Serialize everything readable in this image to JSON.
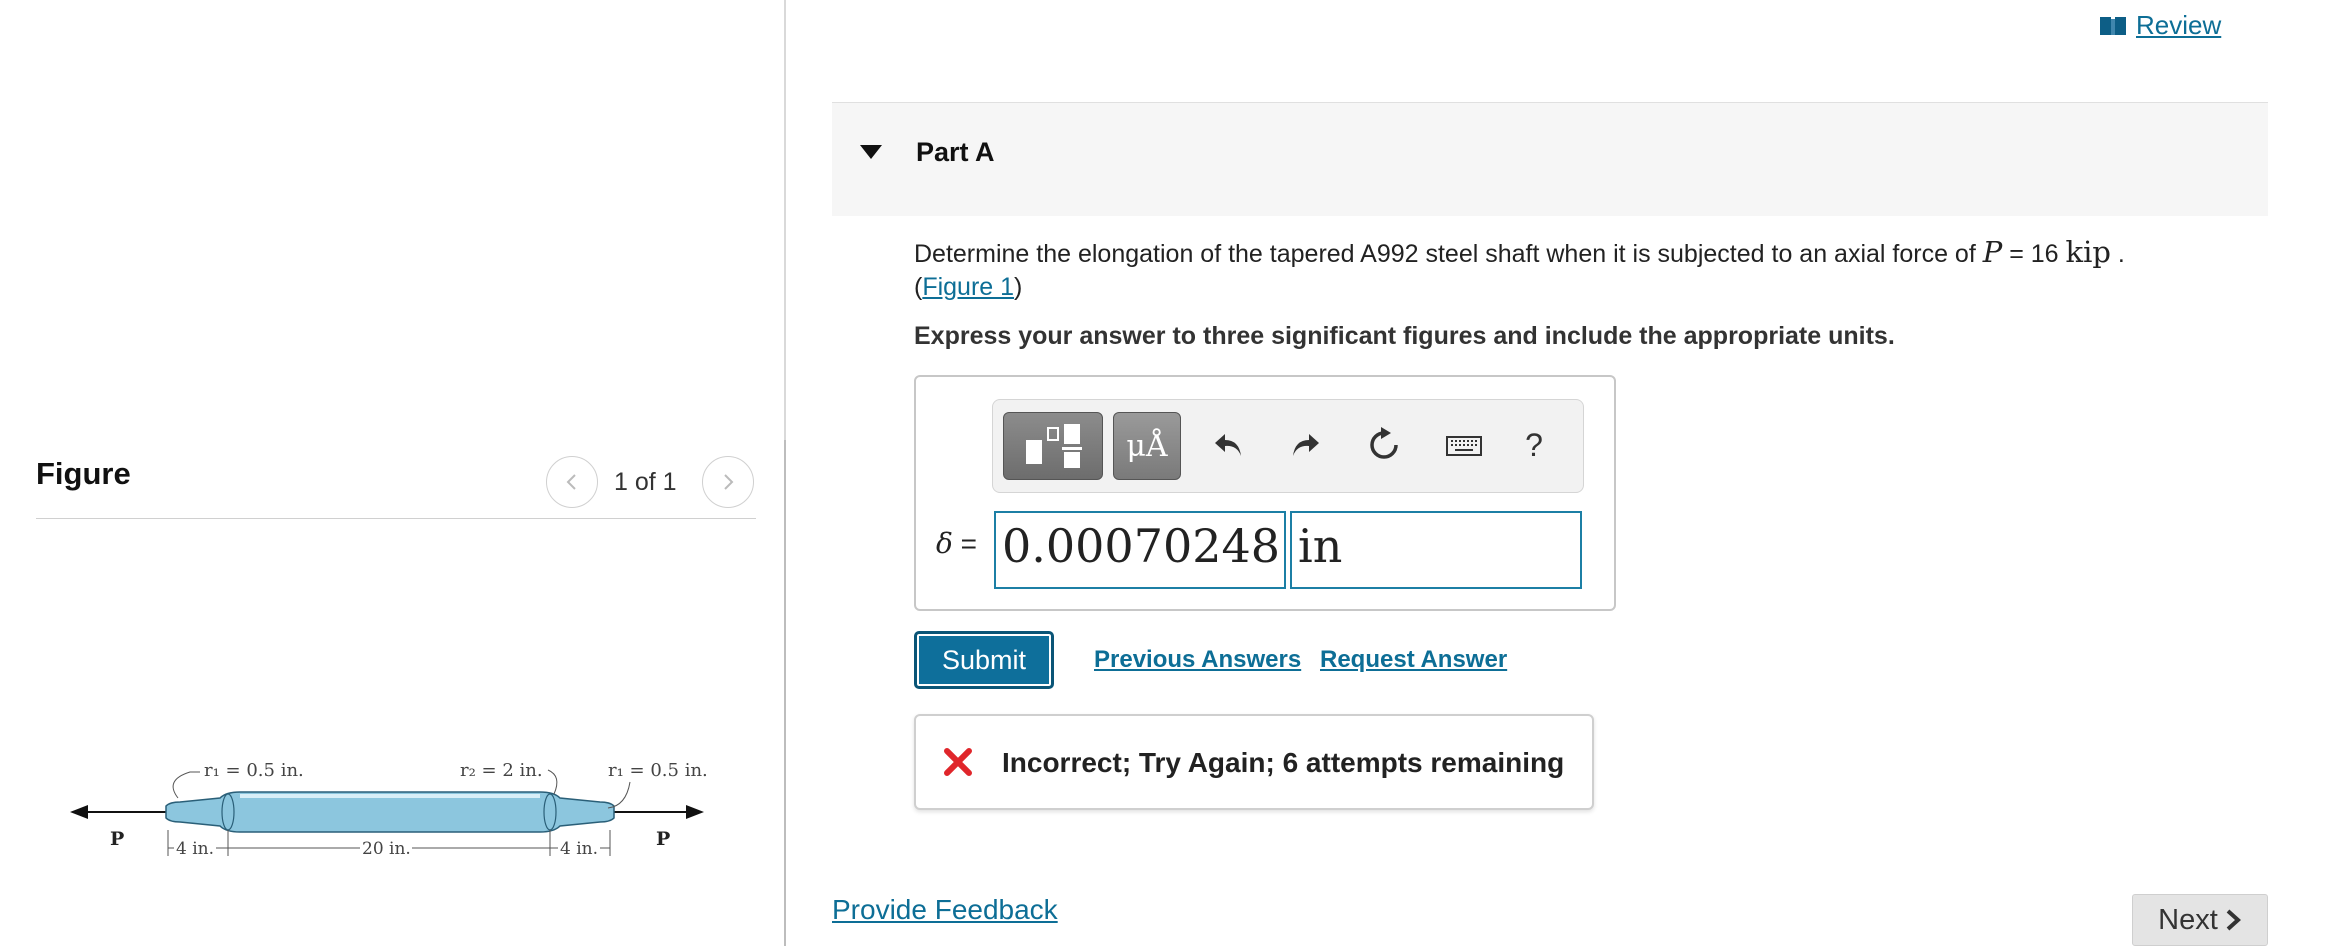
{
  "review": {
    "label": "Review"
  },
  "figure_panel": {
    "title": "Figure",
    "pager": "1 of 1",
    "diagram": {
      "r1_left": "r₁ = 0.5 in.",
      "r2": "r₂ = 2 in.",
      "r1_right": "r₁ = 0.5 in.",
      "dim_left": "4 in.",
      "dim_middle": "20 in.",
      "dim_right": "4 in.",
      "force_left": "P",
      "force_right": "P"
    }
  },
  "part": {
    "title": "Part A"
  },
  "question": {
    "text": "Determine the elongation of the tapered A992 steel shaft when it is subjected to an axial force of",
    "var": "P",
    "equals": " = 16 ",
    "unit": "kip",
    "period": " .",
    "open_paren": "(",
    "figure_link": "Figure 1",
    "close_paren": ")",
    "instruction": "Express your answer to three significant figures and include the appropriate units."
  },
  "answer": {
    "var": "δ",
    "equals": " =",
    "value": "0.00070248",
    "unit": "in"
  },
  "toolbar": {
    "units_label": "μÅ",
    "help_label": "?",
    "icons": [
      "templates-icon",
      "units-icon",
      "undo-icon",
      "redo-icon",
      "reset-icon",
      "keyboard-icon",
      "help-icon"
    ]
  },
  "actions": {
    "submit": "Submit",
    "previous_answers": "Previous Answers",
    "request_answer": "Request Answer"
  },
  "feedback": {
    "message": "Incorrect; Try Again; 6 attempts remaining"
  },
  "footer": {
    "provide_feedback": "Provide Feedback",
    "next": "Next"
  },
  "colors": {
    "accent": "#0e6f9b",
    "link": "#0d6e96",
    "error": "#e0262b",
    "shaft": "#8cc6de"
  }
}
